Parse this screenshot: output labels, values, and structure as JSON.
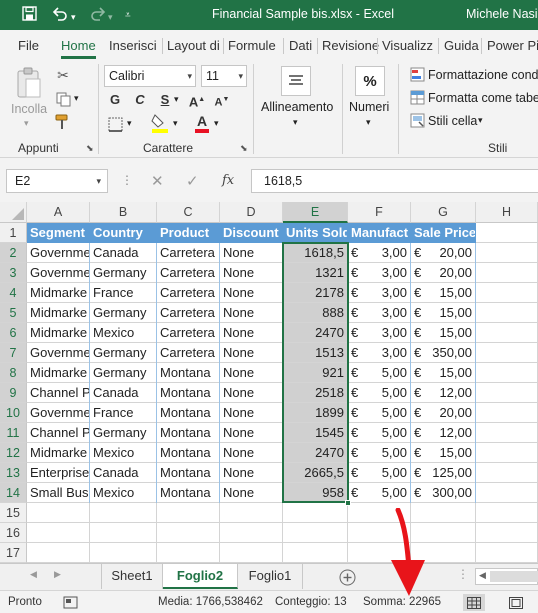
{
  "titlebar": {
    "title": "Financial Sample bis.xlsx  -  Excel",
    "user": "Michele Nasi",
    "undo_icon": "undo-icon",
    "redo_icon": "redo-icon",
    "save_icon": "save-icon"
  },
  "ribbon_tabs": [
    "File",
    "Home",
    "Inserisci",
    "Layout di",
    "Formule",
    "Dati",
    "Revisione",
    "Visualizz",
    "Guida",
    "Power Pi"
  ],
  "ribbon": {
    "paste_label": "Incolla",
    "clipboard_label": "Appunti",
    "font_name": "Calibri",
    "font_size": "11",
    "bold": "G",
    "italic": "C",
    "underline": "S",
    "font_group_label": "Carattere",
    "alignment_label": "Allineamento",
    "number_label": "Numeri",
    "number_symbol": "%",
    "cond_format_label": "Formattazione condiz",
    "format_table_label": "Formatta come tabel",
    "cell_styles_label": "Stili cella",
    "styles_group_label": "Stili"
  },
  "formula_bar": {
    "name_box": "E2",
    "fx": "fx",
    "value": "1618,5"
  },
  "columns": [
    "A",
    "B",
    "C",
    "D",
    "E",
    "F",
    "G",
    "H"
  ],
  "rows": [
    "1",
    "2",
    "3",
    "4",
    "5",
    "6",
    "7",
    "8",
    "9",
    "10",
    "11",
    "12",
    "13",
    "14",
    "15",
    "16",
    "17"
  ],
  "table": {
    "headers": [
      "Segment",
      "Country",
      "Product",
      "Discount",
      "Units Sold",
      "Manufact",
      "Sale Price"
    ],
    "rows": [
      [
        "Governme",
        "Canada",
        "Carretera",
        "None",
        "1618,5",
        "3,00",
        "20,00"
      ],
      [
        "Governme",
        "Germany",
        "Carretera",
        "None",
        "1321",
        "3,00",
        "20,00"
      ],
      [
        "Midmarke",
        "France",
        "Carretera",
        "None",
        "2178",
        "3,00",
        "15,00"
      ],
      [
        "Midmarke",
        "Germany",
        "Carretera",
        "None",
        "888",
        "3,00",
        "15,00"
      ],
      [
        "Midmarke",
        "Mexico",
        "Carretera",
        "None",
        "2470",
        "3,00",
        "15,00"
      ],
      [
        "Governme",
        "Germany",
        "Carretera",
        "None",
        "1513",
        "3,00",
        "350,00"
      ],
      [
        "Midmarke",
        "Germany",
        "Montana",
        "None",
        "921",
        "5,00",
        "15,00"
      ],
      [
        "Channel P",
        "Canada",
        "Montana",
        "None",
        "2518",
        "5,00",
        "12,00"
      ],
      [
        "Governme",
        "France",
        "Montana",
        "None",
        "1899",
        "5,00",
        "20,00"
      ],
      [
        "Channel P",
        "Germany",
        "Montana",
        "None",
        "1545",
        "5,00",
        "12,00"
      ],
      [
        "Midmarke",
        "Mexico",
        "Montana",
        "None",
        "2470",
        "5,00",
        "15,00"
      ],
      [
        "Enterprise",
        "Canada",
        "Montana",
        "None",
        "2665,5",
        "5,00",
        "125,00"
      ],
      [
        "Small Busi",
        "Mexico",
        "Montana",
        "None",
        "958",
        "5,00",
        "300,00"
      ]
    ],
    "currency_symbol": "€"
  },
  "sheet_tabs": [
    "Sheet1",
    "Foglio2",
    "Foglio1"
  ],
  "active_sheet": "Foglio2",
  "status": {
    "ready": "Pronto",
    "average": "Media: 1766,538462",
    "count": "Conteggio: 13",
    "sum": "Somma: 22965"
  },
  "colors": {
    "excel_green": "#217346",
    "table_header_blue": "#5b9bd5",
    "annotation_red": "#e8141a"
  }
}
